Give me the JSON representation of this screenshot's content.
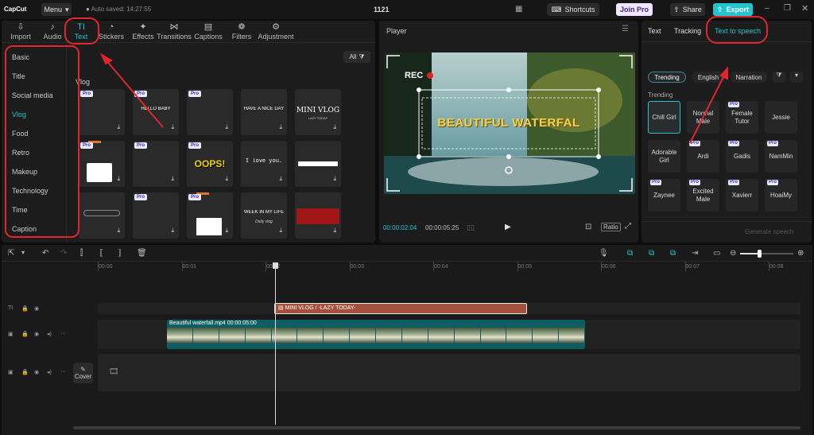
{
  "app": {
    "logo": "CapCut",
    "menu": "Menu",
    "autosave": "Auto saved: 14:27:55",
    "project": "1121",
    "shortcuts": "Shortcuts",
    "join_pro": "Join Pro",
    "share": "Share",
    "export": "Export"
  },
  "tabs": [
    {
      "label": "Import",
      "icon": "import-icon"
    },
    {
      "label": "Audio",
      "icon": "audio-icon"
    },
    {
      "label": "Text",
      "icon": "text-icon"
    },
    {
      "label": "Stickers",
      "icon": "stickers-icon"
    },
    {
      "label": "Effects",
      "icon": "effects-icon"
    },
    {
      "label": "Transitions",
      "icon": "transitions-icon"
    },
    {
      "label": "Captions",
      "icon": "captions-icon"
    },
    {
      "label": "Filters",
      "icon": "filters-icon"
    },
    {
      "label": "Adjustment",
      "icon": "adjustment-icon"
    }
  ],
  "categories": [
    "Basic",
    "Title",
    "Social media",
    "Vlog",
    "Food",
    "Retro",
    "Makeup",
    "Technology",
    "Time",
    "Caption"
  ],
  "library": {
    "filter": "All",
    "section": "Vlog",
    "pro": "Pro",
    "tiles": [
      "",
      "HELLO BABY",
      "",
      "HAVE A NICE DAY",
      "MINI VLOG",
      "",
      "",
      "OOPS!",
      "I love you.",
      "",
      "",
      "",
      "",
      "WEEK IN MY LIFE",
      ""
    ],
    "mini_vlog_sub": "LAZY TODAY",
    "week_sub": "Daily vlog"
  },
  "player": {
    "title": "Player",
    "overlay_text": "BEAUTIFUL WATERFAL",
    "rec": "REC",
    "time_current": "00:00:02:04",
    "time_total": "00:00:05:25",
    "ratio": "Ratio"
  },
  "right": {
    "tabs": [
      "Text",
      "Tracking",
      "Text to speech"
    ],
    "chips": [
      "Trending",
      "English",
      "Narration"
    ],
    "section": "Trending",
    "pro": "Pro",
    "voices": [
      "Chill Girl",
      "Normal Male",
      "Female Tutor",
      "Jessie",
      "Adorable Girl",
      "Ardi",
      "Gadis",
      "NamMin",
      "Zaynee",
      "Excited Male",
      "Xavierr",
      "HoaiMy"
    ],
    "generate": "Generate speech"
  },
  "timeline": {
    "ticks": [
      "00:00",
      "00:01",
      "00:02",
      "00:03",
      "00:04",
      "00:05",
      "00:06",
      "00:07",
      "00:08"
    ],
    "text_clip": "MINI VLOG / -LAZY TODAY-",
    "video_clip": "Beautiful waterfall.mp4  00:00:05:00",
    "cover": "Cover"
  },
  "colors": {
    "accent": "#22c5cf",
    "annotation": "#e0262d",
    "text_clip": "#a3503c",
    "video_clip": "#0f5d63"
  }
}
